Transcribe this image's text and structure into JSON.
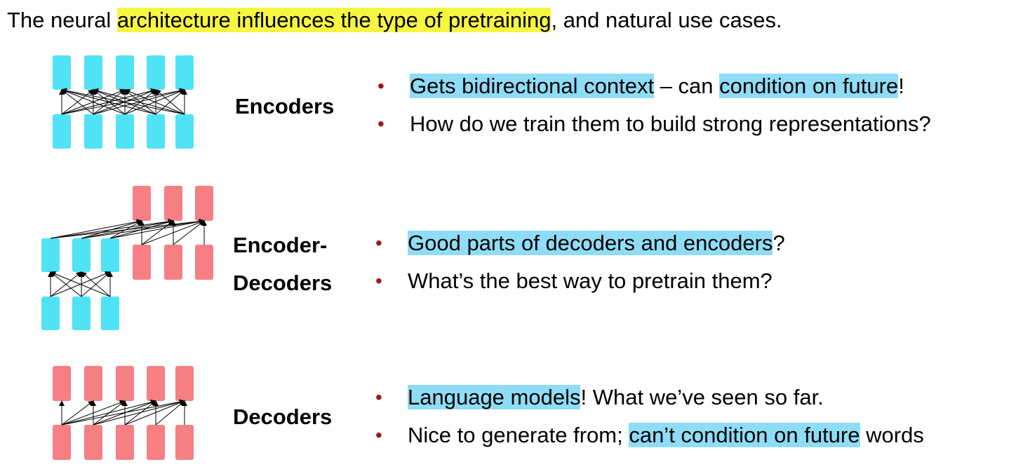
{
  "title": {
    "pre": "The neural ",
    "highlight": "architecture influences the type of pretraining",
    "post": ", and natural use cases."
  },
  "bullet_glyph": "•",
  "sections": {
    "encoders": {
      "label": "Encoders",
      "bullets": [
        {
          "hl1": "Gets bidirectional context",
          "mid": " – can ",
          "hl2": "condition on future",
          "end": "!"
        },
        {
          "text": "How do we train them to build strong representations?"
        }
      ]
    },
    "encoder_decoders": {
      "label_line1": "Encoder-",
      "label_line2": "Decoders",
      "bullets": [
        {
          "hl1": "Good parts of decoders and encoders",
          "end": "?"
        },
        {
          "text": "What’s the best way to pretrain them?"
        }
      ]
    },
    "decoders": {
      "label": "Decoders",
      "bullets": [
        {
          "hl1": "Language models",
          "end": "! What we’ve seen so far."
        },
        {
          "pre": "Nice to generate from; ",
          "hl1": "can’t condition on future",
          "end": " words"
        }
      ]
    }
  },
  "colors": {
    "encoder_block": "#4fe3f5",
    "decoder_block": "#f57f82",
    "title_highlight": "#f6f642",
    "text_highlight": "#8fdcf6",
    "bullet": "#a31616"
  }
}
